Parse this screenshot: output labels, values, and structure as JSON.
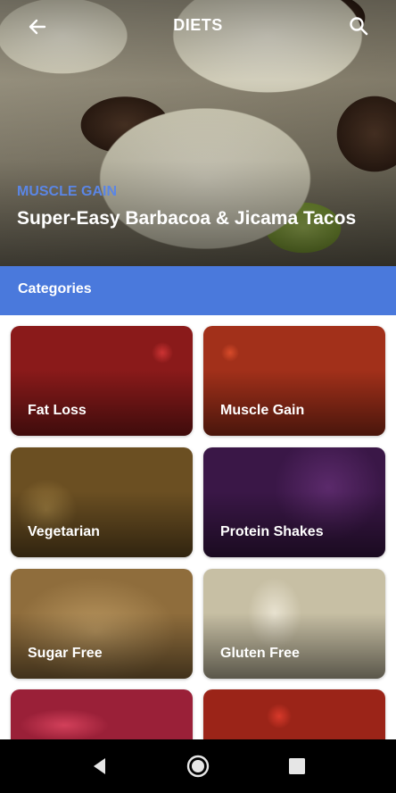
{
  "header": {
    "title": "DIETS",
    "back_icon": "arrow-left-icon",
    "search_icon": "search-icon"
  },
  "hero": {
    "tag": "MUSCLE GAIN",
    "title": "Super-Easy Barbacoa & Jicama Tacos",
    "tag_color": "#5b86e5"
  },
  "categories": {
    "heading": "Categories",
    "accent": "#4a79dc",
    "items": [
      {
        "label": "Fat Loss"
      },
      {
        "label": "Muscle Gain"
      },
      {
        "label": "Vegetarian"
      },
      {
        "label": "Protein Shakes"
      },
      {
        "label": "Sugar Free"
      },
      {
        "label": "Gluten Free"
      },
      {
        "label": ""
      },
      {
        "label": ""
      }
    ]
  },
  "system_nav": {
    "back_icon": "triangle-back-icon",
    "home_icon": "circle-home-icon",
    "recents_icon": "square-recents-icon"
  }
}
